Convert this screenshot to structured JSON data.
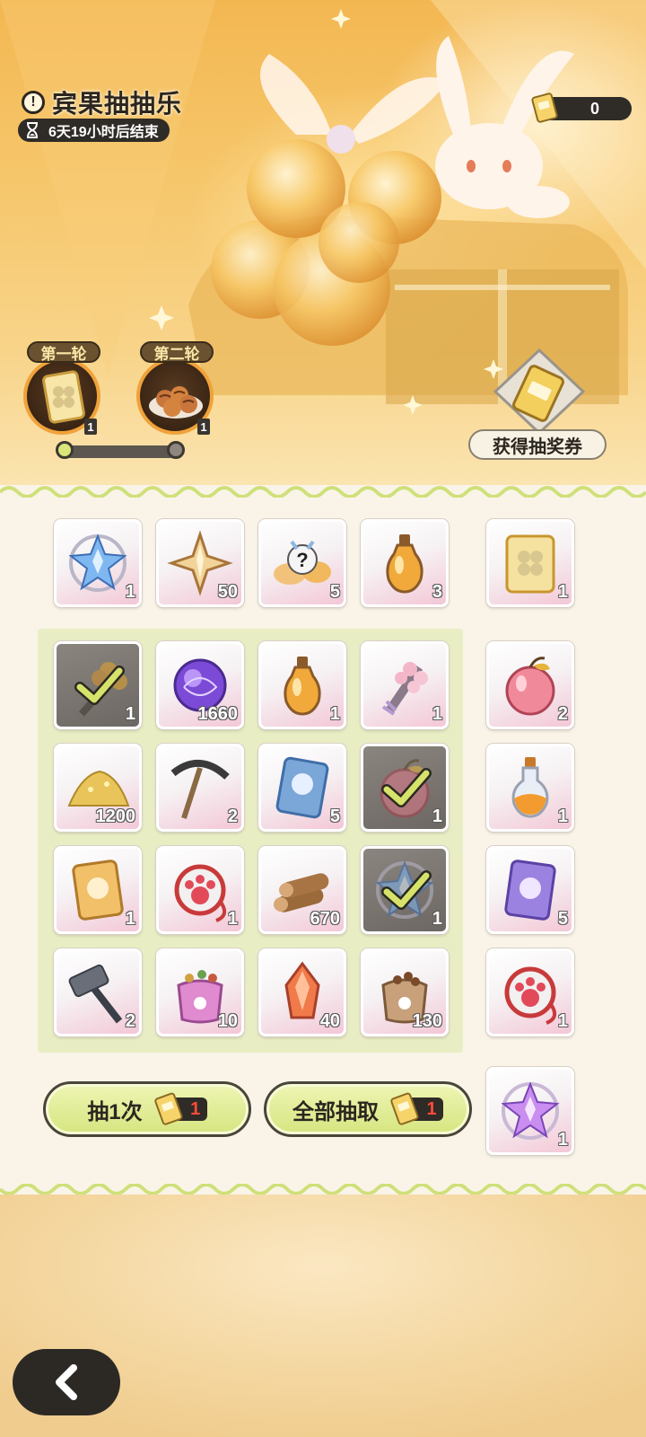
{
  "header": {
    "title": "宾果抽抽乐",
    "info_icon": "info-icon",
    "timer_text": "6天19小时后结束",
    "ticket_count": "0"
  },
  "rounds": [
    {
      "label": "第一轮",
      "icon": "clover-ticket-icon",
      "qty": "1"
    },
    {
      "label": "第二轮",
      "icon": "takoyaki-plate-icon",
      "qty": "1"
    }
  ],
  "round_progress": {
    "reached": 1,
    "total": 2
  },
  "get_ticket_button": {
    "label": "获得抽奖券",
    "icon": "lottery-ticket-icon"
  },
  "top_row": [
    {
      "icon": "blue-star-crystal-icon",
      "qty": "1"
    },
    {
      "icon": "gold-star-fragment-icon",
      "qty": "50"
    },
    {
      "icon": "mystery-spirit-icon",
      "qty": "5"
    },
    {
      "icon": "amber-potion-icon",
      "qty": "3"
    }
  ],
  "grid": [
    [
      {
        "icon": "flower-bouquet-icon",
        "qty": "1",
        "done": true
      },
      {
        "icon": "purple-orb-icon",
        "qty": "1660",
        "done": false
      },
      {
        "icon": "amber-potion-icon",
        "qty": "1",
        "done": false
      },
      {
        "icon": "cherry-blossom-bouquet-icon",
        "qty": "1",
        "done": false
      }
    ],
    [
      {
        "icon": "gold-dust-pile-icon",
        "qty": "1200",
        "done": false
      },
      {
        "icon": "pickaxe-icon",
        "qty": "2",
        "done": false
      },
      {
        "icon": "blue-character-card-icon",
        "qty": "5",
        "done": false
      },
      {
        "icon": "apple-icon",
        "qty": "1",
        "done": true
      }
    ],
    [
      {
        "icon": "gold-character-card-icon",
        "qty": "1",
        "done": false
      },
      {
        "icon": "paw-charm-icon",
        "qty": "1",
        "done": false
      },
      {
        "icon": "wood-logs-icon",
        "qty": "670",
        "done": false
      },
      {
        "icon": "blue-star-crystal-icon",
        "qty": "1",
        "done": true
      }
    ],
    [
      {
        "icon": "hammer-icon",
        "qty": "2",
        "done": false
      },
      {
        "icon": "pink-food-bag-icon",
        "qty": "10",
        "done": false
      },
      {
        "icon": "red-crystal-icon",
        "qty": "40",
        "done": false
      },
      {
        "icon": "brown-sack-icon",
        "qty": "130",
        "done": false
      }
    ]
  ],
  "side_column": [
    {
      "icon": "clover-ticket-icon",
      "qty": "1"
    },
    {
      "icon": "pink-apple-icon",
      "qty": "2"
    },
    {
      "icon": "orange-potion-bottle-icon",
      "qty": "1"
    },
    {
      "icon": "purple-character-card-icon",
      "qty": "5"
    },
    {
      "icon": "paw-charm-icon",
      "qty": "1"
    },
    {
      "icon": "purple-star-crystal-icon",
      "qty": "1"
    }
  ],
  "actions": {
    "draw_once_label": "抽1次",
    "draw_once_cost": "1",
    "draw_all_label": "全部抽取",
    "draw_all_cost": "1"
  },
  "back_button": {
    "icon": "chevron-left-icon"
  },
  "colors": {
    "accent_green": "#d6e57f",
    "panel": "#faf4e8",
    "dark": "#2f2b27",
    "cost_red": "#ff4a3a"
  }
}
